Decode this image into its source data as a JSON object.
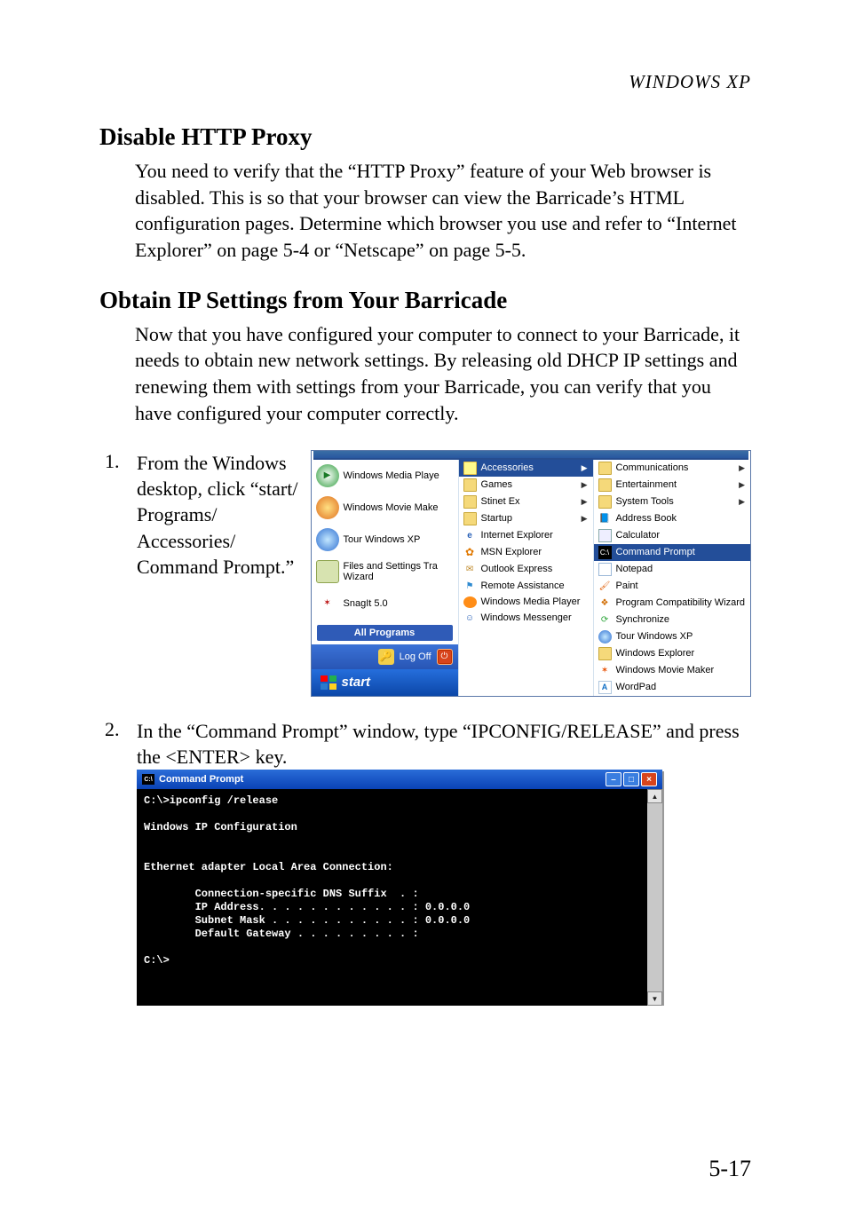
{
  "header": {
    "label": "WINDOWS XP"
  },
  "sections": {
    "proxy": {
      "title": "Disable HTTP Proxy",
      "body": "You need to verify that the “HTTP Proxy” feature of your Web browser is disabled. This is so that your browser can view the Barricade’s HTML configuration pages. Determine which browser you use and refer to “Internet Explorer” on page 5-4 or “Netscape” on page 5-5."
    },
    "ip": {
      "title": "Obtain IP Settings from Your Barricade",
      "body": "Now that you have configured your computer to connect to your Barricade, it needs to obtain new network settings. By releasing old DHCP IP settings and renewing them with settings from your Barricade, you can verify that you have configured your computer correctly."
    }
  },
  "steps": {
    "s1": {
      "num": "1.",
      "text": "From the Windows desktop, click “start/ Programs/ Accessories/ Command Prompt.”"
    },
    "s2": {
      "num": "2.",
      "text": "In the “Command Prompt” window, type “IPCONFIG/RELEASE” and press the <ENTER> key."
    }
  },
  "startmenu": {
    "left": {
      "wmp": "Windows Media Playe",
      "moviemk": "Windows Movie Make",
      "tour": "Tour Windows XP",
      "files": "Files and Settings Tra",
      "wizard": "Wizard",
      "snag": "SnagIt 5.0",
      "all": "All Programs",
      "logoff": "Log Off",
      "start": "start"
    },
    "mid": {
      "accessories": "Accessories",
      "games": "Games",
      "stinet": "Stinet Ex",
      "startup": "Startup",
      "ie": "Internet Explorer",
      "msn": "MSN Explorer",
      "oe": "Outlook Express",
      "ra": "Remote Assistance",
      "wmp": "Windows Media Player",
      "msgr": "Windows Messenger"
    },
    "right": {
      "comm": "Communications",
      "ent": "Entertainment",
      "systools": "System Tools",
      "addr": "Address Book",
      "calc": "Calculator",
      "cmd": "Command Prompt",
      "notepad": "Notepad",
      "paint": "Paint",
      "wiz": "Program Compatibility Wizard",
      "sync": "Synchronize",
      "tour": "Tour Windows XP",
      "explorer": "Windows Explorer",
      "moviemk": "Windows Movie Maker",
      "wordpad": "WordPad"
    }
  },
  "cmd": {
    "title": "Command Prompt",
    "lines": "C:\\>ipconfig /release\n\nWindows IP Configuration\n\n\nEthernet adapter Local Area Connection:\n\n        Connection-specific DNS Suffix  . :\n        IP Address. . . . . . . . . . . . : 0.0.0.0\n        Subnet Mask . . . . . . . . . . . : 0.0.0.0\n        Default Gateway . . . . . . . . . :\n\nC:\\>"
  },
  "pageNumber": "5-17"
}
